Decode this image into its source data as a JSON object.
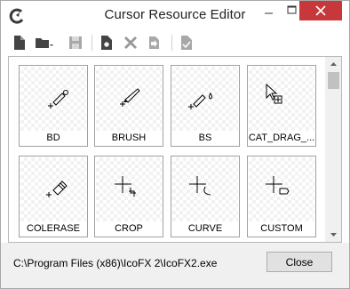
{
  "window": {
    "title": "Cursor Resource Editor",
    "app_icon": "icofx-logo-icon",
    "caption_buttons": [
      "minimize-icon",
      "maximize-icon",
      "close-icon"
    ]
  },
  "toolbar": {
    "buttons": [
      {
        "name": "new-file-icon"
      },
      {
        "name": "open-folder-icon",
        "has_dropdown": true
      },
      {
        "name": "save-icon",
        "disabled": true
      },
      {
        "name": "new-cursor-icon"
      },
      {
        "name": "delete-icon",
        "disabled": true
      },
      {
        "name": "import-icon",
        "disabled": true
      },
      {
        "name": "apply-icon",
        "disabled": true
      }
    ]
  },
  "cursors": [
    {
      "label": "BD",
      "icon": "pen-erase-icon"
    },
    {
      "label": "BRUSH",
      "icon": "brush-icon"
    },
    {
      "label": "BS",
      "icon": "pen-drop-icon"
    },
    {
      "label": "CAT_DRAG_...",
      "icon": "arrow-drag-icon"
    },
    {
      "label": "COLERASE",
      "icon": "eraser-icon"
    },
    {
      "label": "CROP",
      "icon": "crop-icon"
    },
    {
      "label": "CURVE",
      "icon": "curve-icon"
    },
    {
      "label": "CUSTOM",
      "icon": "custom-shape-icon"
    }
  ],
  "status": {
    "path": "C:\\Program Files (x86)\\IcoFX 2\\IcoFX2.exe",
    "close_label": "Close"
  }
}
